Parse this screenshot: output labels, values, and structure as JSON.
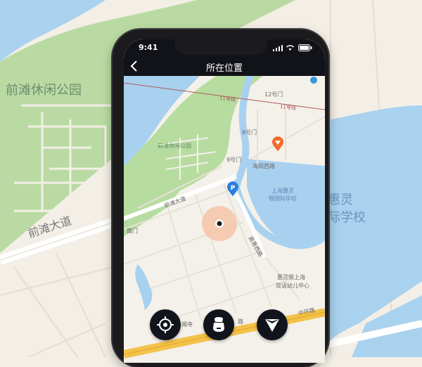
{
  "status_bar": {
    "time": "9:41"
  },
  "nav": {
    "title": "所在位置",
    "back_icon": "chevron-left-icon"
  },
  "background_map": {
    "park_label": "前滩休闲公园",
    "road_label": "前滩大道",
    "school_label_line1": "惠灵",
    "school_label_line2": "际学校"
  },
  "screen_map": {
    "metro_line_label_1": "11号线",
    "metro_line_label_2": "11号线",
    "gate_12": "12号门",
    "gate_8": "8号门",
    "gate_9": "9号门",
    "gate_south": "南门",
    "park_label": "前滩休闲公园",
    "road_qiantan": "前滩大道",
    "road_haiyang": "海阳西路",
    "road_gaoqing": "高青西路",
    "road_zhonghuan": "中环路",
    "school_line1": "上海惠灵",
    "school_line2": "顿国际学校",
    "kindergarten_line1": "惠灵顿上海",
    "kindergarten_line2": "双语幼儿中心",
    "bottom_road": "路",
    "bottom_temple": "闽寺",
    "parking_icon": "parking-icon",
    "poi_icon": "red-arrow-poi-icon"
  },
  "controls": {
    "locate": "locate-icon",
    "scooter": "scooter-icon",
    "navigate": "navigate-icon"
  },
  "colors": {
    "nav_bg": "#121318",
    "park_green": "#b7dca0",
    "water_blue": "#a8d1ef",
    "road_yellow": "#f3c24a",
    "location_ring": "#f4c4a8"
  }
}
